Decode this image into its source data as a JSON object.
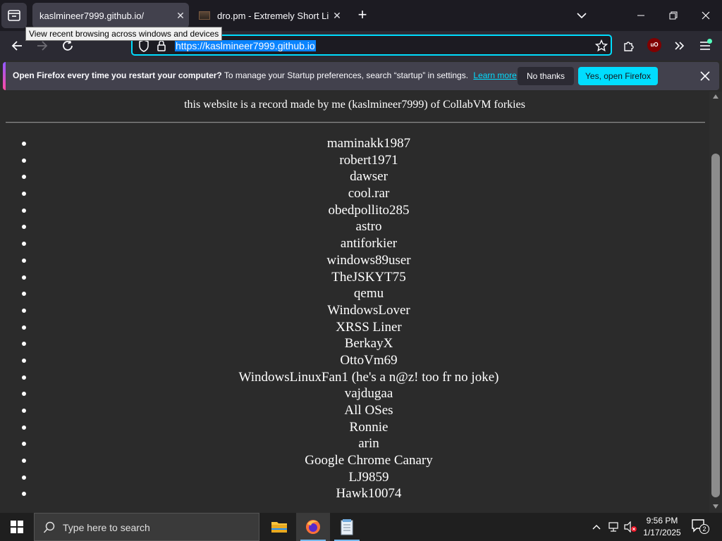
{
  "browser": {
    "tabs": [
      {
        "title": "kaslmineer7999.github.io/",
        "active": true
      },
      {
        "title": "dro.pm - Extremely Short Links",
        "active": false
      }
    ],
    "tooltip": "View recent browsing across windows and devices",
    "url": "https://kaslmineer7999.github.io",
    "extension_badge": "uO"
  },
  "notification": {
    "bold": "Open Firefox every time you restart your computer?",
    "text": "To manage your Startup preferences, search “startup” in settings.",
    "link": "Learn more",
    "no_thanks": "No thanks",
    "yes": "Yes, open Firefox"
  },
  "page": {
    "intro": "this website is a record made by me (kaslmineer7999) of CollabVM forkies",
    "forkies": [
      "maminakk1987",
      "robert1971",
      "dawser",
      "cool.rar",
      "obedpollito285",
      "astro",
      "antiforkier",
      "windows89user",
      "TheJSKYT75",
      "qemu",
      "WindowsLover",
      "XRSS Liner",
      "BerkayX",
      "OttoVm69",
      "WindowsLinuxFan1 (he's a n@z! too fr no joke)",
      "vajdugaa",
      "All OSes",
      "Ronnie",
      "arin",
      "Google Chrome Canary",
      "LJ9859",
      "Hawk10074"
    ]
  },
  "taskbar": {
    "search_placeholder": "Type here to search",
    "time": "9:56 PM",
    "date": "1/17/2025",
    "notifications_count": "2"
  },
  "colors": {
    "accent": "#00ddff",
    "selection": "#0a84ff",
    "page_bg": "#2b2b2b"
  }
}
